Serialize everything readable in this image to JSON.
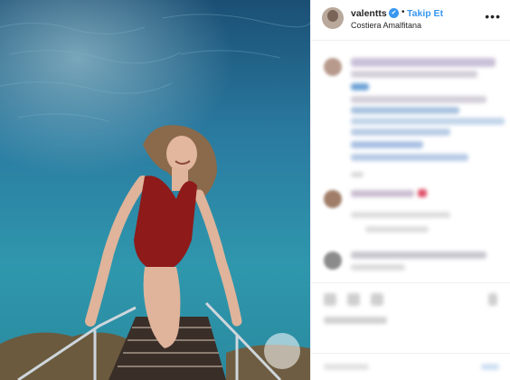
{
  "post": {
    "username": "valentts",
    "verified_badge": "✔",
    "separator": "•",
    "follow_label": "Takip Et",
    "location": "Costiera Amalfitana",
    "more_icon": "more-icon"
  },
  "colors": {
    "sea": "#2a8aa6",
    "swimsuit": "#8e1a1a",
    "accent": "#3897f0"
  }
}
